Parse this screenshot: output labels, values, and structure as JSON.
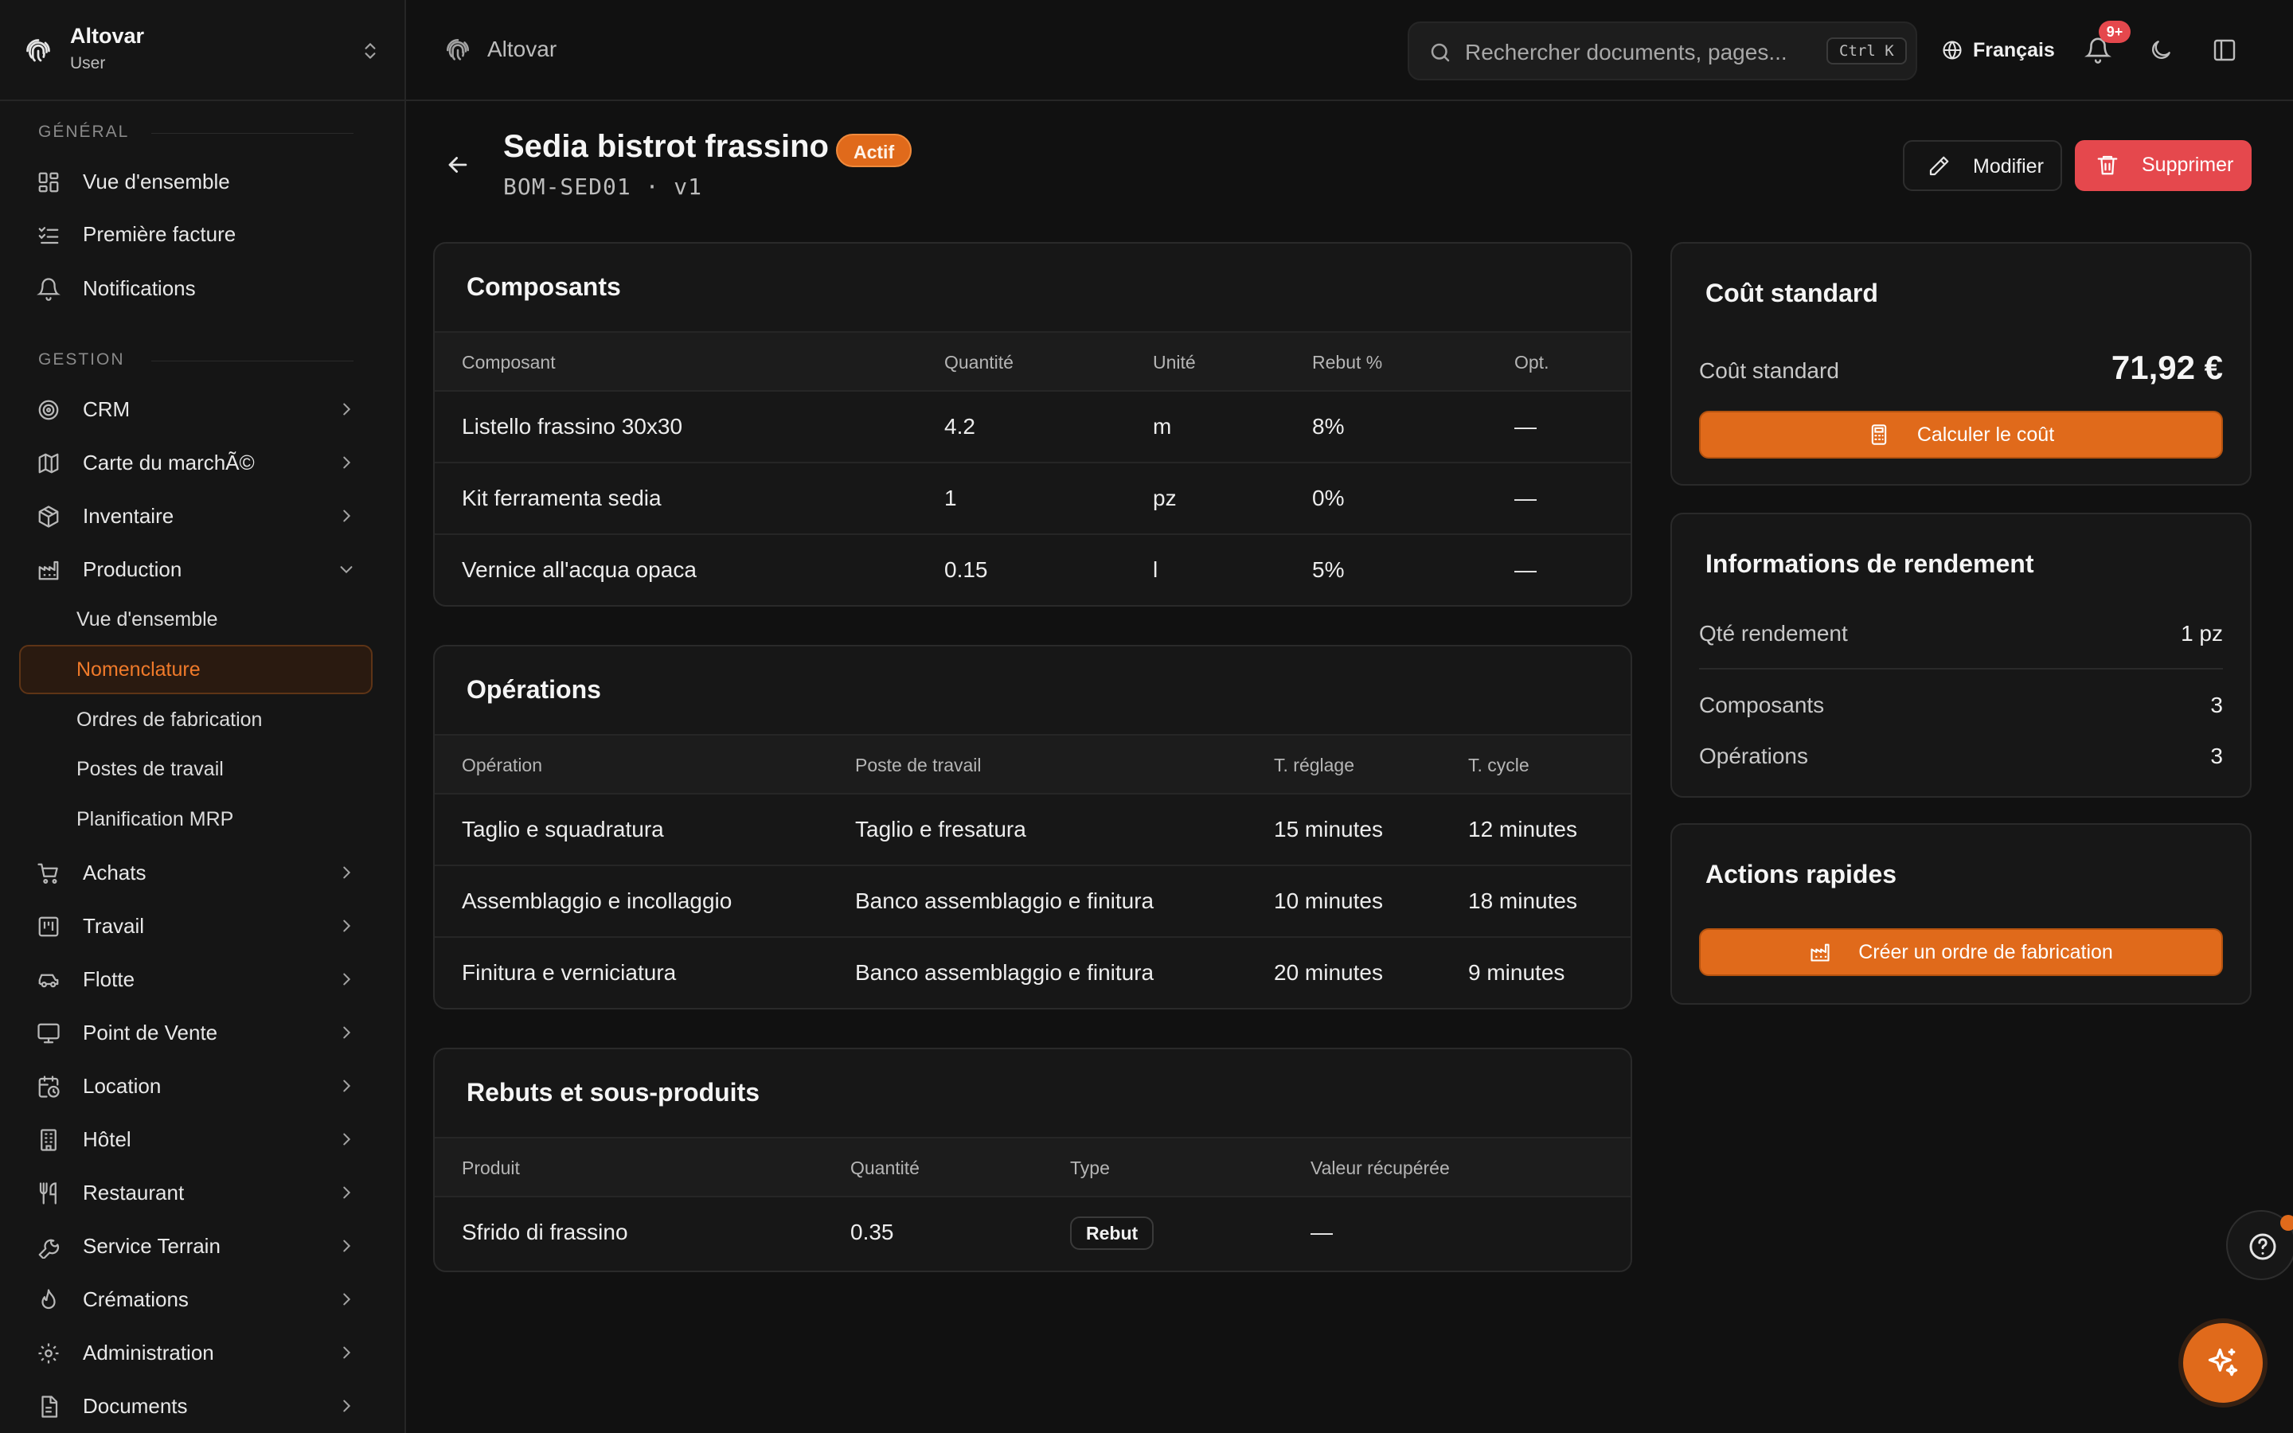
{
  "app": {
    "name": "Altovar",
    "role": "User"
  },
  "topbar": {
    "crumb": "Altovar",
    "search_placeholder": "Rechercher documents, pages...",
    "search_shortcut": "Ctrl K",
    "language": "Français",
    "notifications_badge": "9+"
  },
  "sidebar": {
    "section_general": "GÉNÉRAL",
    "general_items": [
      {
        "label": "Vue d'ensemble",
        "icon": "dashboard-icon"
      },
      {
        "label": "Première facture",
        "icon": "checklist-icon"
      },
      {
        "label": "Notifications",
        "icon": "bell-icon"
      }
    ],
    "section_gestion": "GESTION",
    "gestion_items": [
      {
        "label": "CRM",
        "icon": "target-icon"
      },
      {
        "label": "Carte du marchÃ©",
        "icon": "map-icon"
      },
      {
        "label": "Inventaire",
        "icon": "package-icon"
      },
      {
        "label": "Production",
        "icon": "factory-icon"
      }
    ],
    "production_sub": [
      {
        "label": "Vue d'ensemble"
      },
      {
        "label": "Nomenclature",
        "active": true
      },
      {
        "label": "Ordres de fabrication"
      },
      {
        "label": "Postes de travail"
      },
      {
        "label": "Planification MRP"
      }
    ],
    "more_items": [
      {
        "label": "Achats",
        "icon": "cart-icon"
      },
      {
        "label": "Travail",
        "icon": "kanban-icon"
      },
      {
        "label": "Flotte",
        "icon": "car-icon"
      },
      {
        "label": "Point de Vente",
        "icon": "monitor-icon"
      },
      {
        "label": "Location",
        "icon": "calendar-clock-icon"
      },
      {
        "label": "Hôtel",
        "icon": "building-icon"
      },
      {
        "label": "Restaurant",
        "icon": "utensils-icon"
      },
      {
        "label": "Service Terrain",
        "icon": "wrench-icon"
      },
      {
        "label": "Crémations",
        "icon": "flame-icon"
      },
      {
        "label": "Administration",
        "icon": "gear-icon"
      },
      {
        "label": "Documents",
        "icon": "document-icon"
      }
    ]
  },
  "page": {
    "title": "Sedia bistrot frassino",
    "status": "Actif",
    "subtitle": "BOM-SED01 · v1",
    "edit_label": "Modifier",
    "delete_label": "Supprimer"
  },
  "components": {
    "title": "Composants",
    "headers": [
      "Composant",
      "Quantité",
      "Unité",
      "Rebut %",
      "Opt."
    ],
    "rows": [
      [
        "Listello frassino 30x30",
        "4.2",
        "m",
        "8%",
        "—"
      ],
      [
        "Kit ferramenta sedia",
        "1",
        "pz",
        "0%",
        "—"
      ],
      [
        "Vernice all'acqua opaca",
        "0.15",
        "l",
        "5%",
        "—"
      ]
    ]
  },
  "operations": {
    "title": "Opérations",
    "headers": [
      "Opération",
      "Poste de travail",
      "T. réglage",
      "T. cycle"
    ],
    "rows": [
      [
        "Taglio e squadratura",
        "Taglio e fresatura",
        "15 minutes",
        "12 minutes"
      ],
      [
        "Assemblaggio e incollaggio",
        "Banco assemblaggio e finitura",
        "10 minutes",
        "18 minutes"
      ],
      [
        "Finitura e verniciatura",
        "Banco assemblaggio e finitura",
        "20 minutes",
        "9 minutes"
      ]
    ]
  },
  "scrap": {
    "title": "Rebuts et sous-produits",
    "headers": [
      "Produit",
      "Quantité",
      "Type",
      "Valeur récupérée"
    ],
    "rows": [
      [
        "Sfrido di frassino",
        "0.35",
        "Rebut",
        "—"
      ]
    ]
  },
  "cost": {
    "title": "Coût standard",
    "label": "Coût standard",
    "value": "71,92 €",
    "button": "Calculer le coût"
  },
  "yield": {
    "title": "Informations de rendement",
    "rows": [
      {
        "label": "Qté rendement",
        "value": "1 pz"
      },
      {
        "label": "Composants",
        "value": "3"
      },
      {
        "label": "Opérations",
        "value": "3"
      }
    ]
  },
  "quick": {
    "title": "Actions rapides",
    "button": "Créer un ordre de fabrication"
  },
  "colors": {
    "accent": "#e06a1b",
    "danger": "#e5484d",
    "background": "#111111"
  }
}
